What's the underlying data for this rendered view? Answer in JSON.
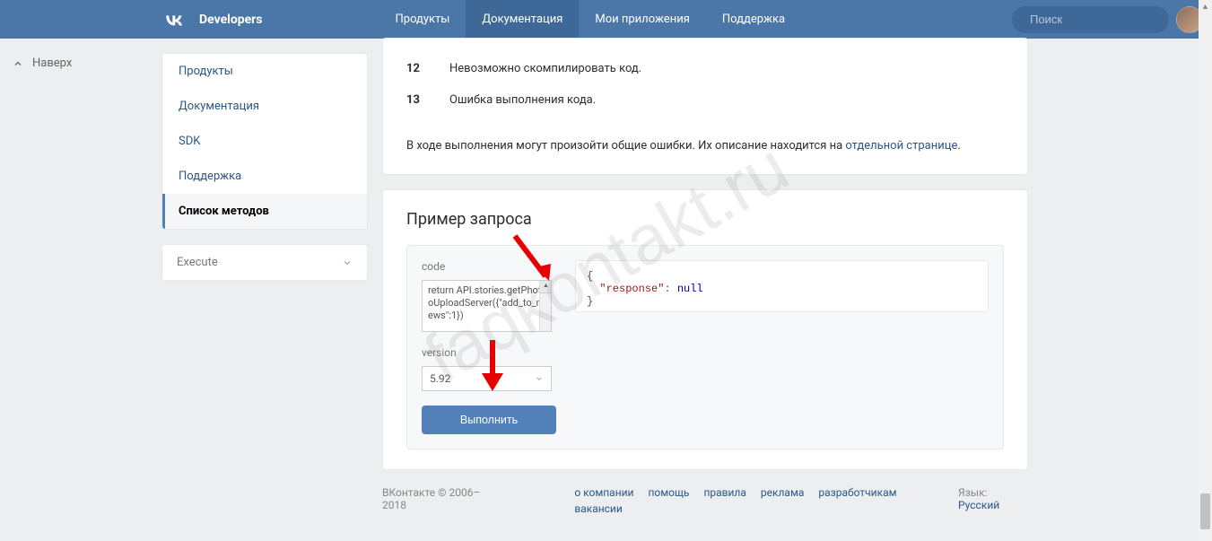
{
  "header": {
    "developers": "Developers",
    "nav": [
      "Продукты",
      "Документация",
      "Мои приложения",
      "Поддержка"
    ],
    "active_nav_index": 1,
    "search_placeholder": "Поиск"
  },
  "scroll_top": "Наверх",
  "sidebar": {
    "items": [
      {
        "label": "Продукты",
        "active": false
      },
      {
        "label": "Документация",
        "active": false
      },
      {
        "label": "SDK",
        "active": false
      },
      {
        "label": "Поддержка",
        "active": false
      },
      {
        "label": "Список методов",
        "active": true
      }
    ],
    "execute": "Execute"
  },
  "errors": [
    {
      "code": "12",
      "desc": "Невозможно скомпилировать код."
    },
    {
      "code": "13",
      "desc": "Ошибка выполнения кода."
    }
  ],
  "errors_note_pre": "В ходе выполнения могут произойти общие ошибки. Их описание находится на ",
  "errors_note_link": "отдельной странице",
  "errors_note_post": ".",
  "request": {
    "title": "Пример запроса",
    "code_label": "code",
    "code_value": "return API.stories.getPhotoUploadServer({\"add_to_news\":1})",
    "version_label": "version",
    "version_value": "5.92",
    "execute_label": "Выполнить",
    "response": {
      "response": null
    }
  },
  "footer": {
    "copy": "ВКонтакте © 2006–2018",
    "links": [
      "о компании",
      "помощь",
      "правила",
      "реклама",
      "разработчикам",
      "вакансии"
    ],
    "lang_label": "Язык:",
    "lang_value": "Русский"
  },
  "watermark": "faqkontakt.ru"
}
